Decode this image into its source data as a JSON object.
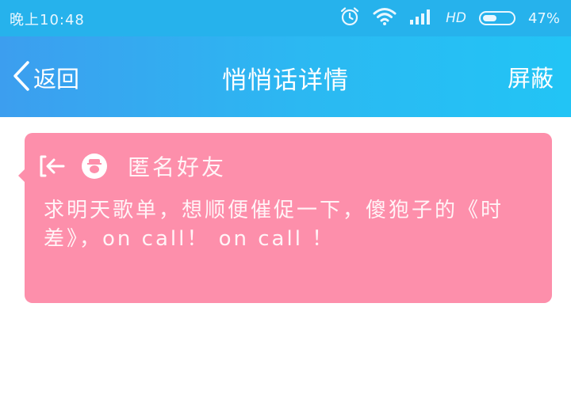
{
  "status_bar": {
    "time": "晚上10:48",
    "network": "HD",
    "battery_percent": "47%",
    "battery_level": 0.47,
    "icons": [
      "alarm-icon",
      "wifi-icon",
      "signal-icon",
      "battery-icon"
    ]
  },
  "nav": {
    "back_label": "返回",
    "title": "悄悄话详情",
    "block_label": "屏蔽"
  },
  "message": {
    "sender": "匿名好友",
    "body": "求明天歌单，想顺便催促一下，傻狍子的《时差》，on call！ on call ！"
  },
  "colors": {
    "status_bar": "#26b2ec",
    "nav_start": "#3c9eef",
    "nav_end": "#22c4f5",
    "card": "#fd8fab",
    "text_on_card": "#fff4f7"
  }
}
